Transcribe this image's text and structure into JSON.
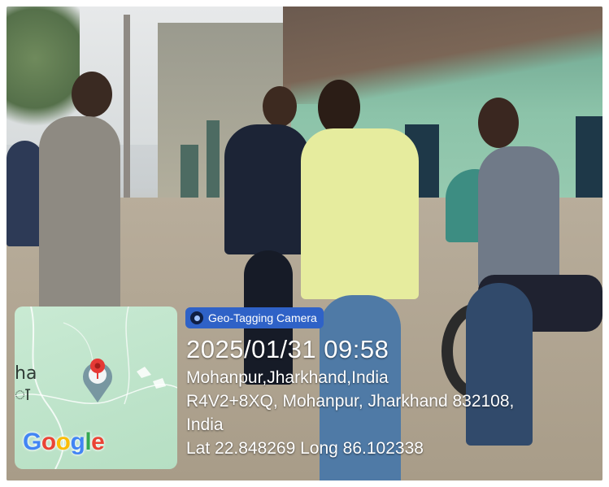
{
  "badge": {
    "label": "Geo-Tagging Camera",
    "icon": "camera-lens-icon"
  },
  "map": {
    "place_latin": "ha",
    "place_devanagari": "ा",
    "pin_icon": "location-pin-icon",
    "logo_text": "Google",
    "logo_colors": [
      "#4285F4",
      "#EA4335",
      "#FBBC05",
      "#4285F4",
      "#34A853",
      "#EA4335"
    ]
  },
  "stamp": {
    "datetime": "2025/01/31 09:58",
    "location": "Mohanpur,Jharkhand,India",
    "address_line1": "R4V2+8XQ, Mohanpur, Jharkhand 832108,",
    "address_line2": "India",
    "coordinates": "Lat 22.848269 Long 86.102338"
  },
  "colors": {
    "badge_bg": "#2f62c7",
    "map_bg": "#c9ead3",
    "pin_red": "#e53935",
    "text": "#ffffff"
  }
}
